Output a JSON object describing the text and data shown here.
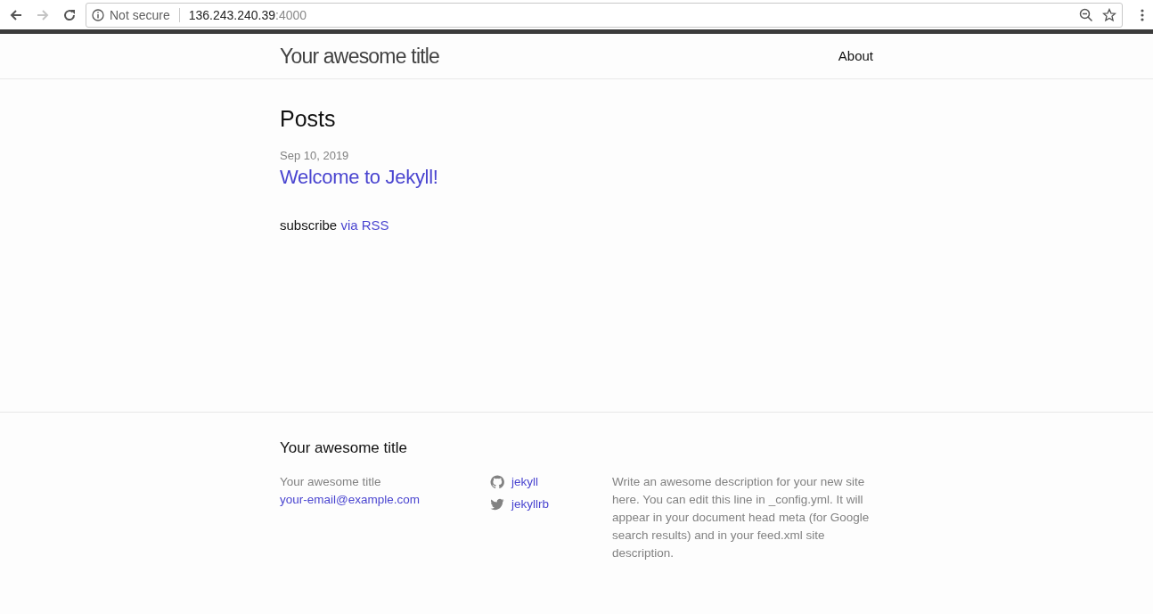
{
  "browser": {
    "back": {
      "disabled": false
    },
    "forward": {
      "disabled": true
    },
    "security": "Not secure",
    "url_host": "136.243.240.39",
    "url_port": ":4000"
  },
  "header": {
    "site_title": "Your awesome title",
    "nav": [
      "About"
    ]
  },
  "main": {
    "heading": "Posts",
    "posts": [
      {
        "date": "Sep 10, 2019",
        "title": "Welcome to Jekyll!"
      }
    ],
    "subscribe": {
      "text": "subscribe",
      "link": "via RSS"
    }
  },
  "footer": {
    "title": "Your awesome title",
    "name": "Your awesome title",
    "email": "your-email@example.com",
    "social": [
      {
        "kind": "github",
        "label": "jekyll"
      },
      {
        "kind": "twitter",
        "label": "jekyllrb"
      }
    ],
    "description": "Write an awesome description for your new site here. You can edit this line in _config.yml. It will appear in your document head meta (for Google search results) and in your feed.xml site description."
  }
}
